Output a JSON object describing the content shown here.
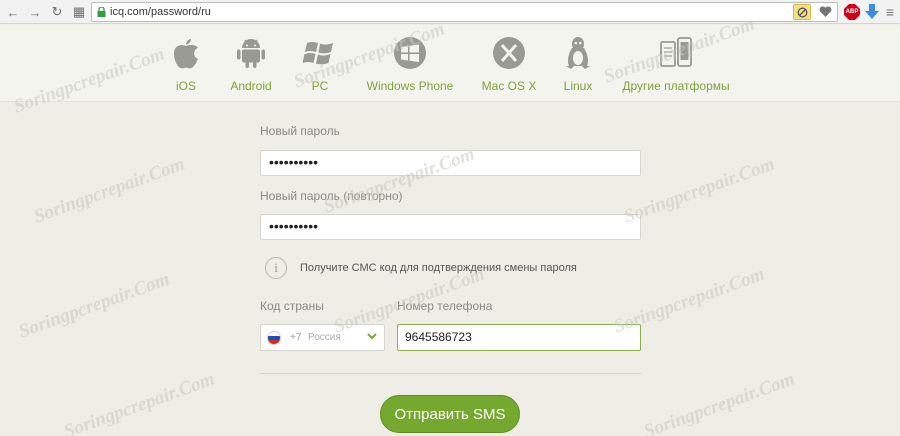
{
  "browser": {
    "url": "icq.com/password/ru",
    "back_glyph": "←",
    "forward_glyph": "→",
    "reload_glyph": "↻",
    "apps_glyph": "▦",
    "abp_label": "ABP"
  },
  "platforms": [
    {
      "label": "iOS",
      "icon": "apple-icon"
    },
    {
      "label": "Android",
      "icon": "android-icon"
    },
    {
      "label": "PC",
      "icon": "windows-logo-icon"
    },
    {
      "label": "Windows Phone",
      "icon": "windows-phone-icon"
    },
    {
      "label": "Mac OS X",
      "icon": "mac-x-icon"
    },
    {
      "label": "Linux",
      "icon": "tux-icon"
    },
    {
      "label": "Другие платформы",
      "icon": "devices-icon"
    }
  ],
  "form": {
    "new_password_label": "Новый пароль",
    "new_password_value": "••••••••••",
    "repeat_password_label": "Новый пароль (повторно)",
    "repeat_password_value": "••••••••••",
    "info_glyph": "i",
    "info_text": "Получите СМС код для подтверждения смены пароля",
    "country_label": "Код страны",
    "country_code": "+7",
    "country_name": "Россия",
    "phone_label": "Номер телефона",
    "phone_value": "9645586723",
    "submit_label": "Отправить SMS"
  },
  "watermark": "Soringpcrepair.Com",
  "colors": {
    "accent_green": "#74a82f",
    "label_green": "#7fa33a"
  }
}
